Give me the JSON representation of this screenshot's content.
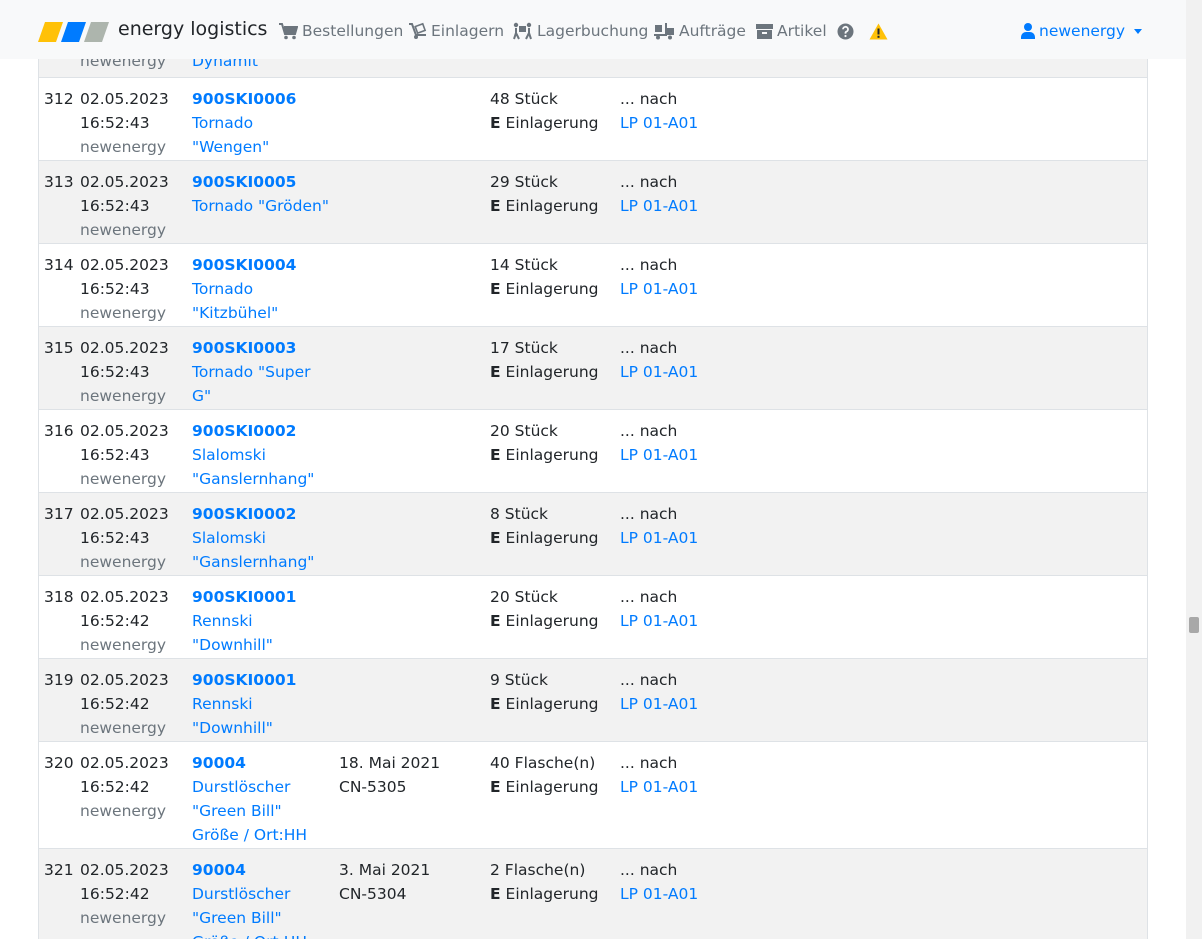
{
  "brand": "energy logistics",
  "nav": [
    {
      "label": "Bestellungen",
      "icon": "cart-icon"
    },
    {
      "label": "Einlagern",
      "icon": "dolly-icon"
    },
    {
      "label": "Lagerbuchung",
      "icon": "people-carry-icon"
    },
    {
      "label": "Aufträge",
      "icon": "truck-loading-icon"
    },
    {
      "label": "Artikel",
      "icon": "box-icon"
    }
  ],
  "user": {
    "name": "newenergy"
  },
  "colors": {
    "link": "#007bff",
    "warning": "#ffc107",
    "logo": [
      "#ffc107",
      "#007bff",
      "#adb5ad"
    ]
  },
  "partial_row": {
    "user": "newenergy",
    "article_name": "Dynamit"
  },
  "rows": [
    {
      "num": "312",
      "date": "02.05.2023",
      "time": "16:52:43",
      "user": "newenergy",
      "code": "900SKI0006",
      "name": "Tornado \"Wengen\"",
      "mhd": "",
      "charge": "",
      "qty": "48 Stück",
      "type_code": "E",
      "type": "Einlagerung",
      "direction": "... nach",
      "location": "LP 01-A01"
    },
    {
      "num": "313",
      "date": "02.05.2023",
      "time": "16:52:43",
      "user": "newenergy",
      "code": "900SKI0005",
      "name": "Tornado \"Gröden\"",
      "mhd": "",
      "charge": "",
      "qty": "29 Stück",
      "type_code": "E",
      "type": "Einlagerung",
      "direction": "... nach",
      "location": "LP 01-A01"
    },
    {
      "num": "314",
      "date": "02.05.2023",
      "time": "16:52:43",
      "user": "newenergy",
      "code": "900SKI0004",
      "name": "Tornado \"Kitzbühel\"",
      "mhd": "",
      "charge": "",
      "qty": "14 Stück",
      "type_code": "E",
      "type": "Einlagerung",
      "direction": "... nach",
      "location": "LP 01-A01"
    },
    {
      "num": "315",
      "date": "02.05.2023",
      "time": "16:52:43",
      "user": "newenergy",
      "code": "900SKI0003",
      "name": "Tornado \"Super G\"",
      "mhd": "",
      "charge": "",
      "qty": "17 Stück",
      "type_code": "E",
      "type": "Einlagerung",
      "direction": "... nach",
      "location": "LP 01-A01"
    },
    {
      "num": "316",
      "date": "02.05.2023",
      "time": "16:52:43",
      "user": "newenergy",
      "code": "900SKI0002",
      "name": "Slalomski \"Ganslernhang\"",
      "mhd": "",
      "charge": "",
      "qty": "20 Stück",
      "type_code": "E",
      "type": "Einlagerung",
      "direction": "... nach",
      "location": "LP 01-A01"
    },
    {
      "num": "317",
      "date": "02.05.2023",
      "time": "16:52:43",
      "user": "newenergy",
      "code": "900SKI0002",
      "name": "Slalomski \"Ganslernhang\"",
      "mhd": "",
      "charge": "",
      "qty": "8 Stück",
      "type_code": "E",
      "type": "Einlagerung",
      "direction": "... nach",
      "location": "LP 01-A01"
    },
    {
      "num": "318",
      "date": "02.05.2023",
      "time": "16:52:42",
      "user": "newenergy",
      "code": "900SKI0001",
      "name": "Rennski \"Downhill\"",
      "mhd": "",
      "charge": "",
      "qty": "20 Stück",
      "type_code": "E",
      "type": "Einlagerung",
      "direction": "... nach",
      "location": "LP 01-A01"
    },
    {
      "num": "319",
      "date": "02.05.2023",
      "time": "16:52:42",
      "user": "newenergy",
      "code": "900SKI0001",
      "name": "Rennski \"Downhill\"",
      "mhd": "",
      "charge": "",
      "qty": "9 Stück",
      "type_code": "E",
      "type": "Einlagerung",
      "direction": "... nach",
      "location": "LP 01-A01"
    },
    {
      "num": "320",
      "date": "02.05.2023",
      "time": "16:52:42",
      "user": "newenergy",
      "code": "90004",
      "name": "Durstlöscher \"Green Bill\" Größe / Ort:HH",
      "mhd": "18. Mai 2021",
      "charge": "CN-5305",
      "qty": "40 Flasche(n)",
      "type_code": "E",
      "type": "Einlagerung",
      "direction": "... nach",
      "location": "LP 01-A01"
    },
    {
      "num": "321",
      "date": "02.05.2023",
      "time": "16:52:42",
      "user": "newenergy",
      "code": "90004",
      "name": "Durstlöscher \"Green Bill\" Größe / Ort:HH",
      "mhd": "3. Mai 2021",
      "charge": "CN-5304",
      "qty": "2 Flasche(n)",
      "type_code": "E",
      "type": "Einlagerung",
      "direction": "... nach",
      "location": "LP 01-A01"
    }
  ]
}
